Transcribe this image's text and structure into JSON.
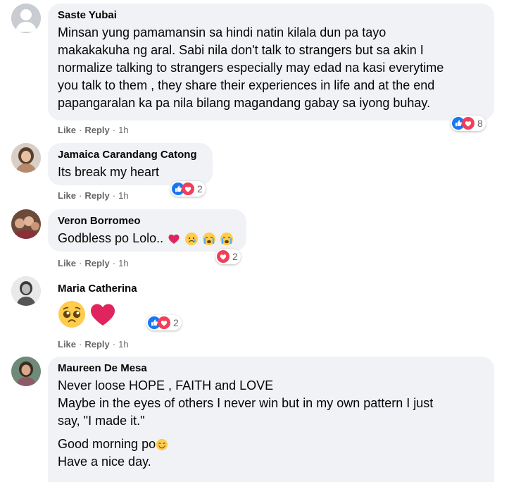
{
  "comments": [
    {
      "name": "Saste Yubai",
      "lines": [
        "Minsan yung pamamansin sa hindi natin kilala dun pa tayo",
        "makakakuha ng aral. Sabi nila don't talk to strangers but sa akin I",
        "normalize talking to strangers especially may edad na kasi everytime",
        "you talk to them , they share their experiences in life and at the end",
        "papangaralan ka pa nila bilang magandang gabay sa iyong buhay."
      ],
      "like": "Like",
      "reply": "Reply",
      "time": "1h",
      "reaction_count": "8"
    },
    {
      "name": "Jamaica Carandang Catong",
      "text": "Its break my heart",
      "like": "Like",
      "reply": "Reply",
      "time": "1h",
      "reaction_count": "2"
    },
    {
      "name": "Veron Borromeo",
      "text": "Godbless po Lolo..",
      "like": "Like",
      "reply": "Reply",
      "time": "1h",
      "reaction_count": "2"
    },
    {
      "name": "Maria Catherina",
      "like": "Like",
      "reply": "Reply",
      "time": "1h",
      "reaction_count": "2"
    },
    {
      "name": "Maureen De Mesa",
      "lines": [
        "Never loose HOPE , FAITH and LOVE",
        "Maybe in the eyes of others I never win but in my own pattern I just",
        "say, \"I made it.\""
      ],
      "greeting": "Good morning po",
      "closing": "Have a nice day."
    }
  ],
  "colors": {
    "bubble": "#f0f2f5",
    "like_blue": "#1877f2",
    "love_red": "#f33e58",
    "meta_gray": "#65676b"
  }
}
